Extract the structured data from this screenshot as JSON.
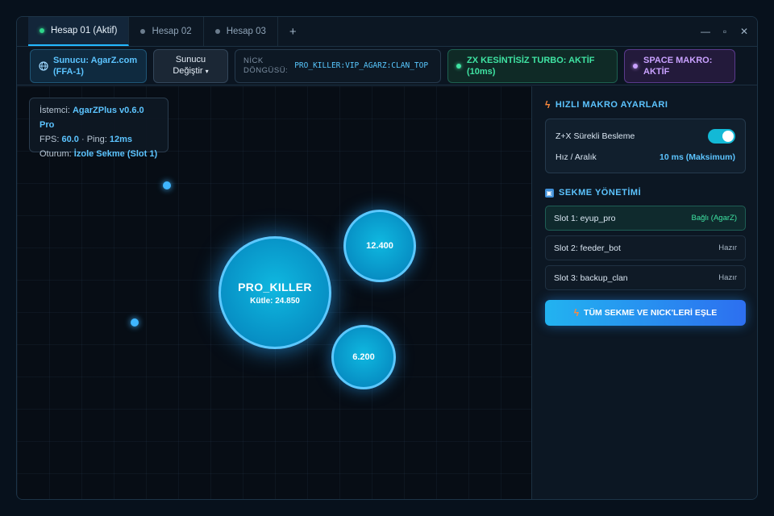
{
  "tabs": [
    {
      "label": "Hesap 01 (Aktif)",
      "active": true
    },
    {
      "label": "Hesap 02",
      "active": false
    },
    {
      "label": "Hesap 03",
      "active": false
    }
  ],
  "tab_add_label": "+",
  "window_controls": {
    "minimize": "—",
    "maximize": "▫",
    "close": "✕"
  },
  "toolbar": {
    "server_line1": "Sunucu: AgarZ.com",
    "server_line2": "(FFA-1)",
    "change_server_line1": "Sunucu",
    "change_server_line2": "Değiştir",
    "nick_label_line1": "NİCK",
    "nick_label_line2": "DÖNGÜSÜ:",
    "nick_value": "PRO_KILLER:VIP_AGARZ:CLAN_TOP",
    "zx_line1": "ZX KESİNTİSİZ TURBO: AKTİF",
    "zx_line2": "(10ms)",
    "space_line1": "SPACE MAKRO:",
    "space_line2": "AKTİF"
  },
  "stats": {
    "client_label": "İstemci:",
    "client_value": "AgarZPlus v0.6.0 Pro",
    "fps_label": "FPS:",
    "fps_value": "60.0",
    "ping_label": "· Ping:",
    "ping_value": "12ms",
    "session_label": "Oturum:",
    "session_value": "İzole Sekme (Slot 1)"
  },
  "game": {
    "main_cell_name": "PRO_KILLER",
    "main_cell_mass": "Kütle: 24.850",
    "cell_b_mass": "12.400",
    "cell_c_mass": "6.200"
  },
  "side": {
    "macro_title": "HIZLI MAKRO AYARLARI",
    "feed_label": "Z+X Sürekli Besleme",
    "feed_enabled": true,
    "speed_label": "Hız / Aralık",
    "speed_value": "10 ms (Maksimum)",
    "tabs_title": "SEKME YÖNETİMİ",
    "slots": [
      {
        "name": "Slot 1: eyup_pro",
        "status": "Bağlı (AgarZ)"
      },
      {
        "name": "Slot 2: feeder_bot",
        "status": "Hazır"
      },
      {
        "name": "Slot 3: backup_clan",
        "status": "Hazır"
      }
    ],
    "sync_button": "TÜM SEKME VE NICK'LERİ EŞLE"
  },
  "colors": {
    "accent": "#23b8ff",
    "success": "#3fe4a3",
    "purple": "#c9a1ff",
    "cell": "#078fc4"
  }
}
